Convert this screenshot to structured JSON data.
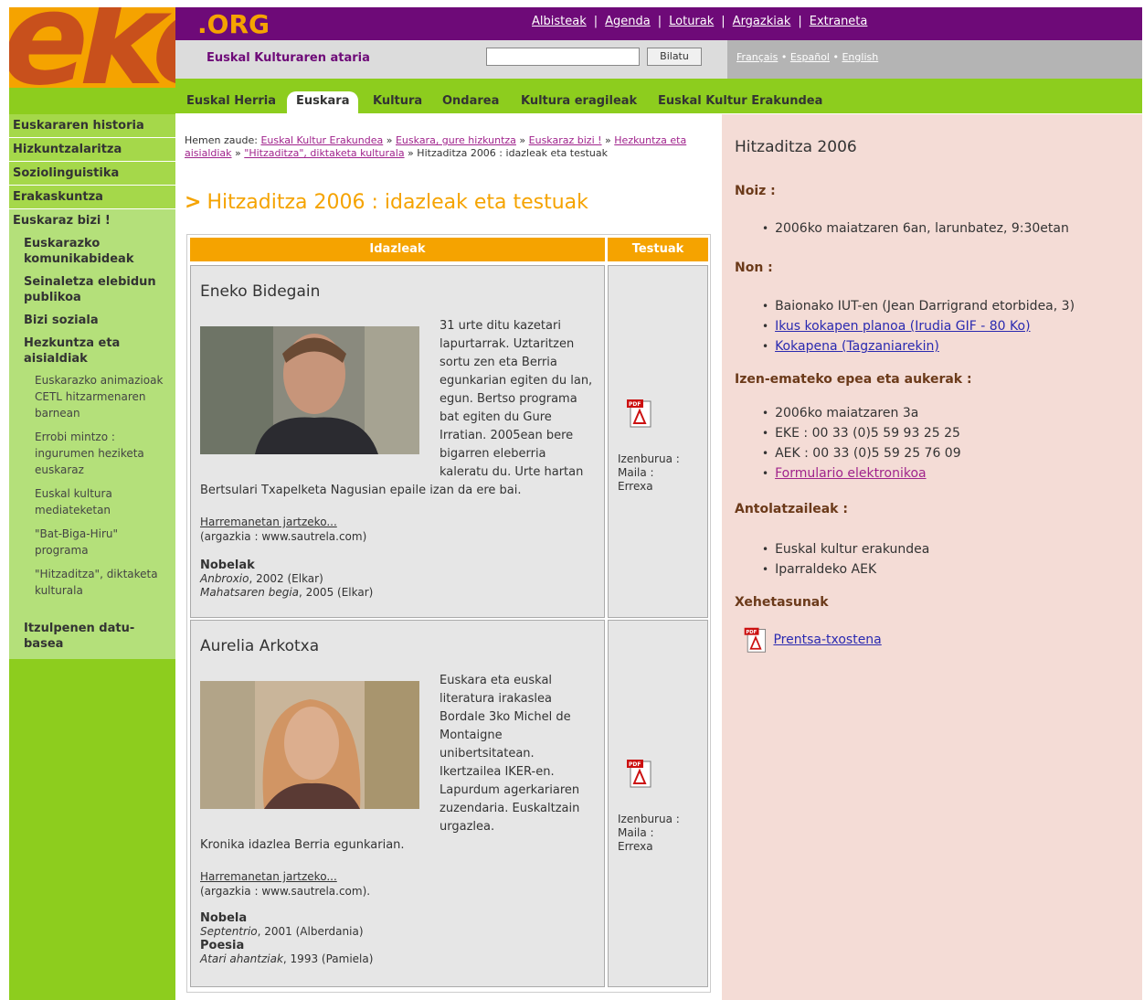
{
  "logo": {
    "text": "eke"
  },
  "header": {
    "org": ".ORG",
    "top_links": [
      "Albisteak",
      "Agenda",
      "Loturak",
      "Argazkiak",
      "Extraneta"
    ],
    "tagline": "Euskal Kulturaren ataria",
    "search_value": "",
    "search_button": "Bilatu",
    "languages": [
      "Français",
      "Español",
      "English"
    ]
  },
  "nav": {
    "tabs": [
      "Euskal Herria",
      "Euskara",
      "Kultura",
      "Ondarea",
      "Kultura eragileak",
      "Euskal Kultur Erakundea"
    ],
    "active": "Euskara"
  },
  "sidebar": {
    "items": [
      "Euskararen historia",
      "Hizkuntzalaritza",
      "Soziolinguistika",
      "Erakaskuntza",
      "Euskaraz bizi !"
    ],
    "subitems": [
      "Euskarazko komunikabideak",
      "Seinaletza elebidun publikoa",
      "Bizi soziala",
      "Hezkuntza eta aisialdiak"
    ],
    "subsubitems": [
      "Euskarazko animazioak CETL hitzarmenaren barnean",
      "Errobi mintzo : ingurumen heziketa euskaraz",
      "Euskal kultura mediateketan",
      "\"Bat-Biga-Hiru\" programa",
      "\"Hitzaditza\", diktaketa kulturala"
    ],
    "last_subitem": "Itzulpenen datu-basea"
  },
  "breadcrumb": {
    "prefix": "Hemen zaude:",
    "links": [
      "Euskal Kultur Erakundea",
      "Euskara, gure hizkuntza",
      "Euskaraz bizi !",
      "Hezkuntza eta aisialdiak",
      "\"Hitzaditza\", diktaketa kulturala"
    ],
    "current": "Hitzaditza 2006 : idazleak eta testuak"
  },
  "page_title": "Hitzaditza 2006 : idazleak eta testuak",
  "table": {
    "headers": [
      "Idazleak",
      "Testuak"
    ],
    "authors": [
      {
        "name": "Eneko Bidegain",
        "bio": "31 urte ditu kazetari lapurtarrak. Uztaritzen sortu zen eta Berria egunkarian egiten du lan, egun. Bertso programa bat egiten du Gure Irratian. 2005ean bere bigarren eleberria kaleratu du. Urte hartan",
        "bio_cont": "Bertsulari Txapelketa Nagusian epaile izan da ere bai.",
        "contact_link": "Harremanetan jartzeko...",
        "photo_credit": "(argazkia : www.sautrela.com)",
        "books_category": "Nobelak",
        "books": [
          {
            "title": "Anbroxio",
            "info": ", 2002 (Elkar)"
          },
          {
            "title": "Mahatsaren begia",
            "info": ", 2005 (Elkar)"
          }
        ],
        "text_meta": [
          "Izenburua :",
          "Maila :",
          "Errexa"
        ]
      },
      {
        "name": "Aurelia Arkotxa",
        "bio": "Euskara eta euskal literatura irakaslea Bordale 3ko Michel de Montaigne unibertsitatean. Ikertzailea IKER-en. Lapurdum agerkariaren zuzendaria. Euskaltzain urgazlea.",
        "bio_cont": "Kronika idazlea Berria egunkarian.",
        "contact_link": "Harremanetan jartzeko...",
        "photo_credit": "(argazkia : www.sautrela.com).",
        "books_category": "Nobela",
        "books": [
          {
            "title": "Septentrio",
            "info": ", 2001 (Alberdania)"
          }
        ],
        "books_category2": "Poesia",
        "books2": [
          {
            "title": "Atari ahantziak",
            "info": ", 1993 (Pamiela)"
          }
        ],
        "text_meta": [
          "Izenburua :",
          "Maila :",
          "Errexa"
        ]
      }
    ]
  },
  "right": {
    "title": "Hitzaditza 2006",
    "noiz_label": "Noiz :",
    "noiz": [
      "2006ko maiatzaren 6an, larunbatez, 9:30etan"
    ],
    "non_label": "Non :",
    "non": [
      "Baionako IUT-en (Jean Darrigrand etorbidea, 3)",
      "Ikus kokapen planoa (Irudia GIF - 80 Ko)",
      "Kokapena (Tagzaniarekin)"
    ],
    "izen_label": "Izen-emateko epea eta aukerak :",
    "izen": [
      "2006ko maiatzaren 3a",
      "EKE : 00 33 (0)5 59 93 25 25",
      "AEK : 00 33 (0)5 59 25 76 09",
      "Formulario elektronikoa"
    ],
    "antol_label": "Antolatzaileak :",
    "antol": [
      "Euskal kultur erakundea",
      "Iparraldeko AEK"
    ],
    "xehe_label": "Xehetasunak",
    "press_link": "Prentsa-txostena"
  },
  "colors": {
    "orange": "#f5a300",
    "purple": "#6e0a78",
    "green": "#8dcd1e",
    "pink": "#f4dcd6"
  }
}
